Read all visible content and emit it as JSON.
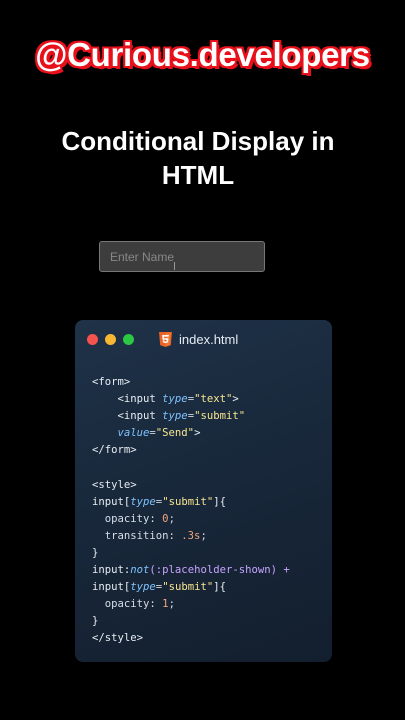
{
  "handle": "@Curious.developers",
  "title": "Conditional Display in HTML",
  "demo": {
    "input_placeholder": "Enter Name"
  },
  "editor": {
    "file_icon": "html5-icon",
    "filename": "index.html",
    "window_controls": [
      "red",
      "yellow",
      "green"
    ],
    "colors": {
      "close": "#f5534f",
      "minimize": "#f6b733",
      "maximize": "#2bc843",
      "attribute": "#7ec3ff",
      "string": "#f6e58f"
    },
    "code_lines": [
      [
        {
          "t": "<form>",
          "c": "tag"
        }
      ],
      [
        {
          "t": "    <input ",
          "c": "tag"
        },
        {
          "t": "type",
          "c": "attr"
        },
        {
          "t": "=",
          "c": "punct"
        },
        {
          "t": "\"text\"",
          "c": "str"
        },
        {
          "t": ">",
          "c": "tag"
        }
      ],
      [
        {
          "t": "    <input ",
          "c": "tag"
        },
        {
          "t": "type",
          "c": "attr"
        },
        {
          "t": "=",
          "c": "punct"
        },
        {
          "t": "\"submit\"",
          "c": "str"
        }
      ],
      [
        {
          "t": "    ",
          "c": "tag"
        },
        {
          "t": "value",
          "c": "attr"
        },
        {
          "t": "=",
          "c": "punct"
        },
        {
          "t": "\"Send\"",
          "c": "str"
        },
        {
          "t": ">",
          "c": "tag"
        }
      ],
      [
        {
          "t": "</form>",
          "c": "tag"
        }
      ],
      [
        {
          "t": "",
          "c": "tag"
        }
      ],
      [
        {
          "t": "<style>",
          "c": "tag"
        }
      ],
      [
        {
          "t": "input[",
          "c": "sel"
        },
        {
          "t": "type",
          "c": "attr"
        },
        {
          "t": "=",
          "c": "punct"
        },
        {
          "t": "\"submit\"",
          "c": "str"
        },
        {
          "t": "]{",
          "c": "sel"
        }
      ],
      [
        {
          "t": "  opacity: ",
          "c": "prop"
        },
        {
          "t": "0",
          "c": "num"
        },
        {
          "t": ";",
          "c": "punct"
        }
      ],
      [
        {
          "t": "  transition: ",
          "c": "prop"
        },
        {
          "t": ".3s",
          "c": "num"
        },
        {
          "t": ";",
          "c": "punct"
        }
      ],
      [
        {
          "t": "}",
          "c": "sel"
        }
      ],
      [
        {
          "t": "input:",
          "c": "sel"
        },
        {
          "t": "not",
          "c": "fn"
        },
        {
          "t": "(:placeholder-shown) +",
          "c": "pseudo"
        }
      ],
      [
        {
          "t": "input[",
          "c": "sel"
        },
        {
          "t": "type",
          "c": "attr"
        },
        {
          "t": "=",
          "c": "punct"
        },
        {
          "t": "\"submit\"",
          "c": "str"
        },
        {
          "t": "]{",
          "c": "sel"
        }
      ],
      [
        {
          "t": "  opacity: ",
          "c": "prop"
        },
        {
          "t": "1",
          "c": "num"
        },
        {
          "t": ";",
          "c": "punct"
        }
      ],
      [
        {
          "t": "}",
          "c": "sel"
        }
      ],
      [
        {
          "t": "</style>",
          "c": "tag"
        }
      ]
    ]
  }
}
